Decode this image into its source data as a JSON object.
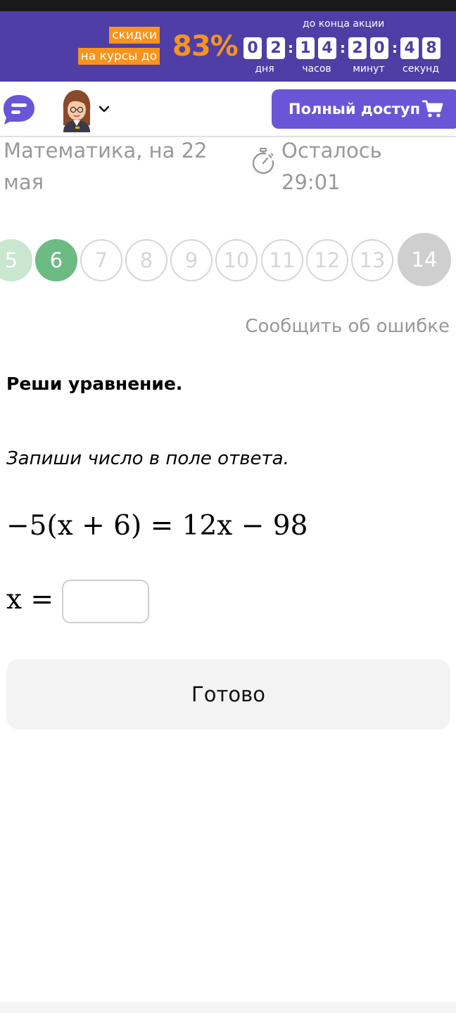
{
  "promo": {
    "discount_line1": "скидки",
    "discount_line2": "на курсы до",
    "percent": "83%",
    "until_end": "до конца акции",
    "countdown": {
      "days": [
        "0",
        "2"
      ],
      "hours": [
        "1",
        "4"
      ],
      "minutes": [
        "2",
        "0"
      ],
      "seconds": [
        "4",
        "8"
      ]
    },
    "units": {
      "days": "дня",
      "hours": "часов",
      "minutes": "минут",
      "seconds": "секунд"
    }
  },
  "header": {
    "logo_icon": "chat-bubble-icon",
    "avatar_icon": "teacher-avatar-icon",
    "full_access_label": "Полный доступ",
    "cart_icon": "cart-icon"
  },
  "test": {
    "title": "Математика, на 22 мая",
    "timer_label": "Осталось",
    "timer_value": "29:01"
  },
  "question_nav": {
    "items": [
      {
        "n": "5",
        "state": "done"
      },
      {
        "n": "6",
        "state": "current"
      },
      {
        "n": "7",
        "state": "todo"
      },
      {
        "n": "8",
        "state": "todo"
      },
      {
        "n": "9",
        "state": "todo"
      },
      {
        "n": "10",
        "state": "todo"
      },
      {
        "n": "11",
        "state": "todo"
      },
      {
        "n": "12",
        "state": "todo"
      },
      {
        "n": "13",
        "state": "todo"
      },
      {
        "n": "14",
        "state": "next"
      }
    ]
  },
  "report_error": "Сообщить об ошибке",
  "task": {
    "heading": "Реши уравнение.",
    "hint": "Запиши число в поле ответа.",
    "equation": "−5(x + 6) = 12x − 98",
    "variable_label": "x =",
    "answer_value": "",
    "submit_label": "Готово"
  },
  "colors": {
    "promo_bg": "#4f3ea6",
    "promo_accent": "#f7941d",
    "primary_button": "#6a55d6",
    "current_question": "#6cbb82",
    "done_question": "#c9e6cf"
  }
}
